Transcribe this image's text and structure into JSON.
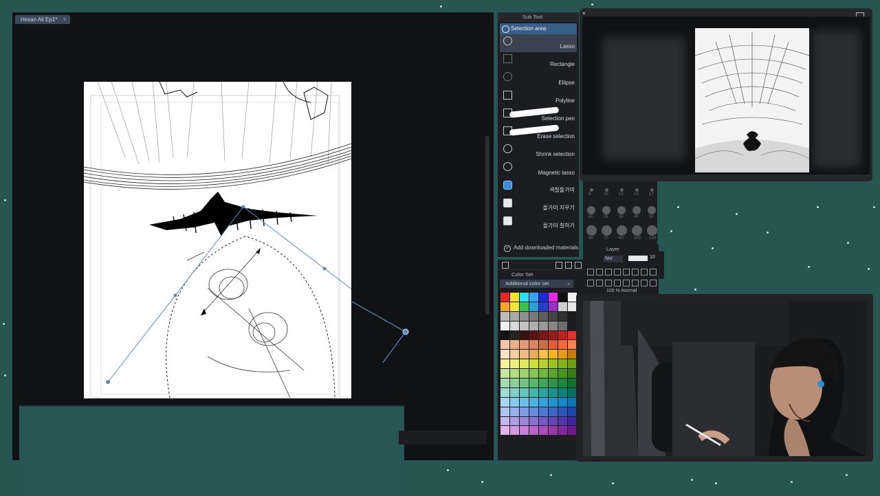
{
  "document": {
    "tab_title": "Hesan Ali Ep1*",
    "close_glyph": "×"
  },
  "subtool": {
    "panel_title": "Sub Tool",
    "group_label": "Selection area",
    "items": [
      {
        "label": "Lasso",
        "icon": "lasso-icon",
        "active": true
      },
      {
        "label": "Rectangle",
        "icon": "rectangle-select-icon"
      },
      {
        "label": "Ellipse",
        "icon": "ellipse-select-icon"
      },
      {
        "label": "Polyline",
        "icon": "polyline-select-icon"
      },
      {
        "label": "Selection pen",
        "icon": "selection-pen-icon"
      },
      {
        "label": "Erase selection",
        "icon": "erase-selection-icon"
      },
      {
        "label": "Shrink selection",
        "icon": "shrink-selection-icon"
      },
      {
        "label": "Magnetic lasso",
        "icon": "magnetic-lasso-icon"
      },
      {
        "label": "색칠둘가미",
        "icon": "fill-lasso-icon"
      },
      {
        "label": "올가미 지우기",
        "icon": "eraser-lasso-icon"
      },
      {
        "label": "올가미 칠하기",
        "icon": "paint-lasso-icon"
      }
    ],
    "add_materials": "Add downloaded materials"
  },
  "colorset": {
    "panel_title": "Color Set",
    "selected_set": "Additional color set",
    "swatches": [
      "#e8262a",
      "#f7e22b",
      "#2ee0f0",
      "#3aa0ff",
      "#1a2bd8",
      "#e229e5",
      "#101010",
      "#f2f2f2",
      "#f5a623",
      "#f6e532",
      "#39c34f",
      "#29a0e0",
      "#2441c8",
      "#9a2cc8",
      "#cfcfcf",
      "#e8e8e8",
      "#bdbdbd",
      "#a9a9a9",
      "#8f8f8f",
      "#787878",
      "#5e5e5e",
      "#454545",
      "#2f2f2f",
      "#1b1b1b",
      "#f0f0f0",
      "#d9d9d9",
      "#c4c4c4",
      "#aeaeae",
      "#999999",
      "#848484",
      "#6e6e6e",
      "#1c1d20",
      "#121212",
      "#242424",
      "#3a1212",
      "#5a1414",
      "#7a1818",
      "#9c1c1c",
      "#c42020",
      "#e83030",
      "#f2c5a8",
      "#eab08e",
      "#e39a75",
      "#d9845e",
      "#c86f48",
      "#e25a3a",
      "#f06a3c",
      "#ff7f50",
      "#fbe2c9",
      "#f5cfa4",
      "#efbc80",
      "#e9a95c",
      "#f6c342",
      "#f3b21f",
      "#e89a10",
      "#c97a08",
      "#f8f19a",
      "#eef07a",
      "#e1ea5a",
      "#cfe03b",
      "#b8d22c",
      "#9ec31f",
      "#84b318",
      "#6ba112",
      "#c8e6a0",
      "#b4dc86",
      "#9ed06c",
      "#87c454",
      "#70b63f",
      "#5aa72e",
      "#46961f",
      "#337f14",
      "#a8dcb0",
      "#8ed09a",
      "#74c384",
      "#5ab56f",
      "#41a65b",
      "#2e964a",
      "#1f853b",
      "#12712f",
      "#9fded6",
      "#80d2c8",
      "#61c5b9",
      "#43b6aa",
      "#2aa69a",
      "#18958a",
      "#0d8377",
      "#046f65",
      "#a9d8f2",
      "#8accec",
      "#6bbfe6",
      "#4db1df",
      "#34a3d7",
      "#2295cd",
      "#1587c2",
      "#0a78b5",
      "#b0c4f0",
      "#97b1ea",
      "#7e9ee3",
      "#668bdb",
      "#5078d2",
      "#3d66c8",
      "#2c55bc",
      "#1f45ae",
      "#c3b6ec",
      "#ae9ee4",
      "#9a87dc",
      "#8670d3",
      "#735ac9",
      "#6146bd",
      "#5035af",
      "#3f26a0",
      "#e0b4e8",
      "#d49ade",
      "#c780d3",
      "#b967c7",
      "#a94fba",
      "#973aab",
      "#83289b",
      "#6e1a88"
    ]
  },
  "layer": {
    "panel_title": "Layer",
    "blend_mode": "Nor",
    "opacity_value": "10",
    "layer_row": "100 % Normal"
  },
  "brush_sizes": [
    "8",
    "10",
    "12",
    "15",
    "17",
    "20",
    "25",
    "30",
    "40",
    "50",
    "60",
    "70",
    "80",
    "100",
    "120"
  ],
  "icons": {
    "nav_close": "×",
    "select_chevron": "⌄",
    "add": "+"
  }
}
